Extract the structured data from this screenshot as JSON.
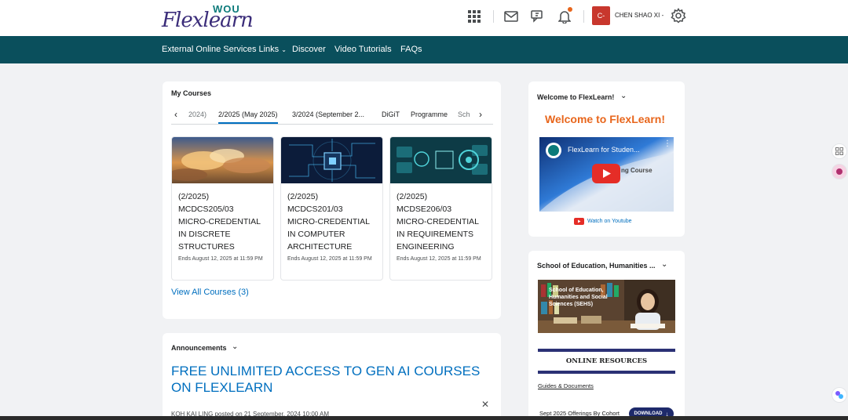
{
  "brand": {
    "wou": "WOU",
    "name": "Flexlearn"
  },
  "header": {
    "avatar_initial": "C-",
    "username": "CHEN SHAO XI -"
  },
  "nav": [
    {
      "label": "External Online Services Links",
      "dropdown": true
    },
    {
      "label": "Discover"
    },
    {
      "label": "Video Tutorials"
    },
    {
      "label": "FAQs"
    }
  ],
  "my_courses": {
    "title": "My Courses",
    "tabs": [
      "2024)",
      "2/2025 (May 2025)",
      "3/2024 (September 2...",
      "DiGiT",
      "Programme",
      "Sch"
    ],
    "active_tab": "2/2025 (May 2025)",
    "courses": [
      {
        "semester": "(2/2025)",
        "code": "MCDCS205/03",
        "name_l1": "MICRO-CREDENTIAL",
        "name_l2": "IN DISCRETE",
        "name_l3": "STRUCTURES",
        "ends": "Ends August 12, 2025 at 11:59 PM"
      },
      {
        "semester": "(2/2025)",
        "code": "MCDCS201/03",
        "name_l1": "MICRO-CREDENTIAL",
        "name_l2": "IN COMPUTER",
        "name_l3": "ARCHITECTURE",
        "ends": "Ends August 12, 2025 at 11:59 PM"
      },
      {
        "semester": "(2/2025)",
        "code": "MCDSE206/03",
        "name_l1": "MICRO-CREDENTIAL",
        "name_l2": "IN REQUIREMENTS",
        "name_l3": "ENGINEERING",
        "ends": "Ends August 12, 2025 at 11:59 PM"
      }
    ],
    "view_all": "View All Courses (3)"
  },
  "announcements": {
    "title": "Announcements",
    "headline": "FREE UNLIMITED ACCESS TO GEN AI COURSES ON FLEXLEARN",
    "meta": "KOH KAI LING posted on 21 September, 2024 10:00 AM"
  },
  "welcome": {
    "title": "Welcome to FlexLearn!",
    "heading": "Welcome to FlexLearn!",
    "video_title": "FlexLearn for Studen...",
    "video_subtitle": "ng Course",
    "watch_label": "Watch on Youtube"
  },
  "school": {
    "title": "School of Education, Humanities ...",
    "image_text": "School of Education, Humanities and Social Sciences (SEHS)",
    "online_resources": "ONLINE RESOURCES",
    "guides": "Guides & Documents",
    "offering": "Sept 2025 Offerings By Cohort",
    "download": "DOWNLOAD"
  },
  "colors": {
    "navbar": "#0a4f5c",
    "link": "#006fbf",
    "accent": "#e8661c"
  }
}
